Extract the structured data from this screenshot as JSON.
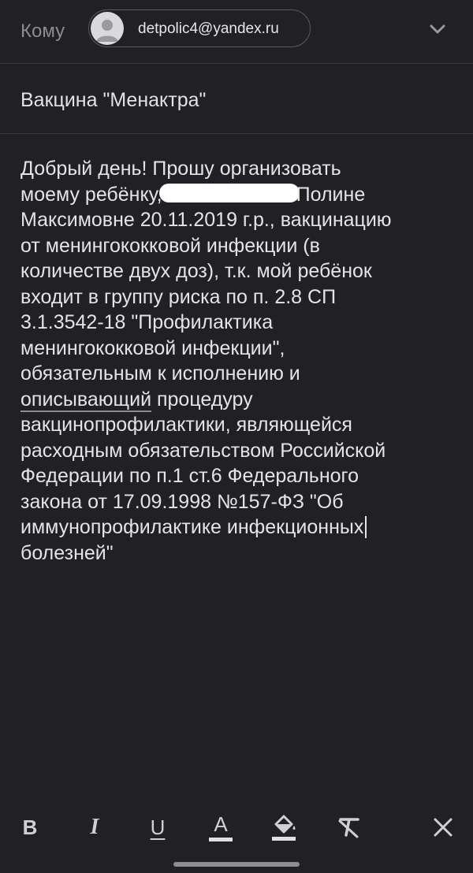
{
  "compose": {
    "to_label": "Кому",
    "recipient": "detpolic4@yandex.ru",
    "subject": "Вакцина \"Менактра\"",
    "body_lines": [
      "Добрый день! Прошу организовать",
      "моему ребёнку,",
      "Полине",
      "Максимовне 20.11.2019 г.р., вакцинацию",
      "от менингококковой инфекции (в",
      "количестве двух доз), т.к. мой ребёнок",
      "входит в группу риска по п. 2.8 СП",
      "3.1.3542-18 \"Профилактика",
      "менингококковой инфекции\",",
      "обязательным к исполнению и",
      "описывающий",
      "процедуру",
      "вакцинопрофилактики, являющейся",
      "расходным обязательством Российской",
      "Федерации по п.1 ст.6 Федерального",
      "закона от 17.09.1998 №157-ФЗ \"Об",
      "иммунопрофилактике инфекционных",
      "болезней\""
    ]
  },
  "toolbar": {
    "bold": "B",
    "italic": "I",
    "underline": "U",
    "text_color": "A"
  },
  "colors": {
    "background": "#212125",
    "text": "#e4e4e6",
    "muted": "#8b8b90"
  }
}
